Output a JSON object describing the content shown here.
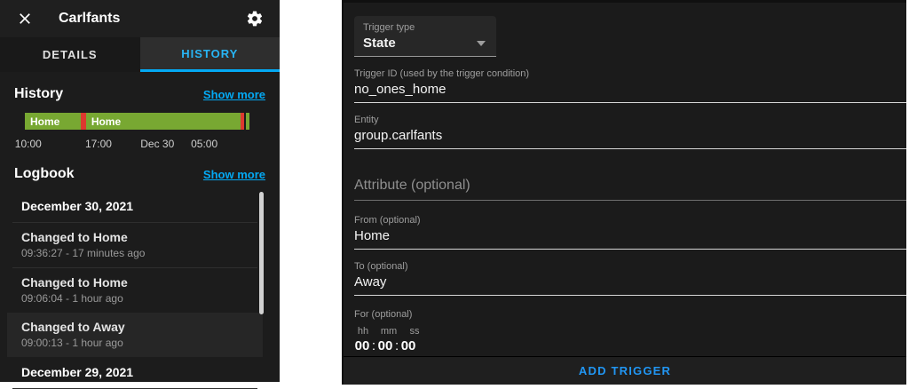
{
  "colors": {
    "accent_blue": "#03a9f4",
    "button_blue": "#2196f3",
    "state_home_green": "#78a832",
    "state_away_red": "#dd392f",
    "panel_bg": "#1c1c1c"
  },
  "left_panel": {
    "title": "Carlfants",
    "close_icon": "close-x",
    "settings_icon": "gear",
    "tabs": [
      {
        "label": "DETAILS",
        "active": false
      },
      {
        "label": "HISTORY",
        "active": true
      }
    ],
    "history": {
      "heading": "History",
      "show_more": "Show more",
      "timeline": {
        "segments": [
          {
            "state": "Home",
            "label": "Home",
            "color": "#78a832",
            "width_pct": 25.0
          },
          {
            "state": "Away",
            "label": "",
            "color": "#dd392f",
            "width_pct": 2.2
          },
          {
            "state": "Home",
            "label": "Home",
            "color": "#78a832",
            "width_pct": 69.0
          },
          {
            "state": "Away",
            "label": "",
            "color": "#dd392f",
            "width_pct": 1.5
          },
          {
            "state": "gap",
            "label": "",
            "color": "#1c1c1c",
            "width_pct": 0.6
          },
          {
            "state": "Home",
            "label": "",
            "color": "#78a832",
            "width_pct": 1.7
          }
        ],
        "axis_ticks": [
          {
            "label": "10:00",
            "left_pct": 1.5
          },
          {
            "label": "17:00",
            "left_pct": 32.8
          },
          {
            "label": "Dec 30",
            "left_pct": 59.0
          },
          {
            "label": "05:00",
            "left_pct": 79.9
          }
        ]
      }
    },
    "logbook": {
      "heading": "Logbook",
      "show_more": "Show more",
      "entries": [
        {
          "type": "date",
          "text": "December 30, 2021"
        },
        {
          "type": "event",
          "title": "Changed to Home",
          "time": "09:36:27 - 17 minutes ago",
          "highlighted": false
        },
        {
          "type": "event",
          "title": "Changed to Home",
          "time": "09:06:04 - 1 hour ago",
          "highlighted": false
        },
        {
          "type": "event",
          "title": "Changed to Away",
          "time": "09:00:13 - 1 hour ago",
          "highlighted": true
        },
        {
          "type": "date",
          "text": "December 29, 2021"
        }
      ]
    }
  },
  "right_panel": {
    "trigger_type": {
      "label": "Trigger type",
      "value": "State"
    },
    "trigger_id": {
      "label": "Trigger ID (used by the trigger condition)",
      "value": "no_ones_home"
    },
    "entity": {
      "label": "Entity",
      "value": "group.carlfants"
    },
    "attribute": {
      "label": "Attribute (optional)",
      "value": ""
    },
    "from": {
      "label": "From (optional)",
      "value": "Home"
    },
    "to": {
      "label": "To (optional)",
      "value": "Away"
    },
    "for": {
      "label": "For (optional)"
    },
    "duration": {
      "units": [
        "hh",
        "mm",
        "ss"
      ],
      "values": [
        "00",
        "00",
        "00"
      ]
    },
    "add_trigger_label": "ADD TRIGGER"
  }
}
